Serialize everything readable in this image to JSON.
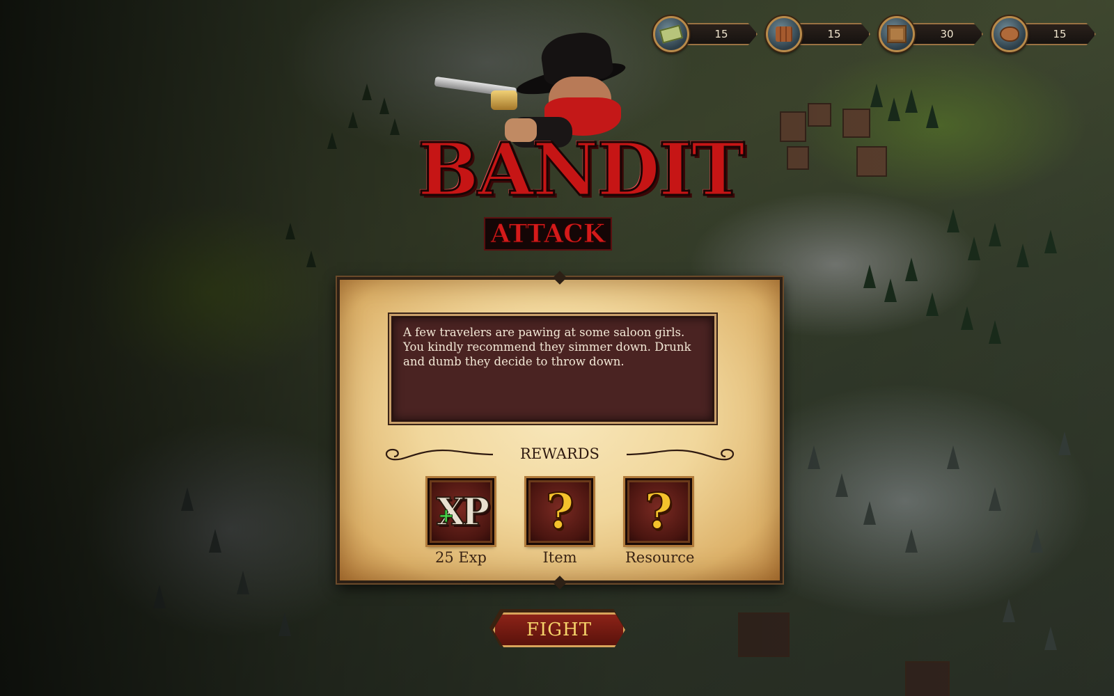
{
  "resources": [
    {
      "icon": "money-icon",
      "value": "15"
    },
    {
      "icon": "wood-icon",
      "value": "15"
    },
    {
      "icon": "crate-icon",
      "value": "30"
    },
    {
      "icon": "food-icon",
      "value": "15"
    }
  ],
  "header": {
    "logo_main": "BANDIT",
    "logo_sub": "ATTACK"
  },
  "event": {
    "description": "A few travelers are pawing at some saloon girls.  You kindly recommend they simmer down.  Drunk and dumb they decide to throw down."
  },
  "rewards": {
    "title": "REWARDS",
    "items": [
      {
        "icon": "xp-icon",
        "icon_text": "XP",
        "label": "25 Exp"
      },
      {
        "icon": "question-mark-icon",
        "icon_text": "?",
        "label": "Item"
      },
      {
        "icon": "question-mark-icon",
        "icon_text": "?",
        "label": "Resource"
      }
    ]
  },
  "actions": {
    "fight_label": "FIGHT"
  }
}
